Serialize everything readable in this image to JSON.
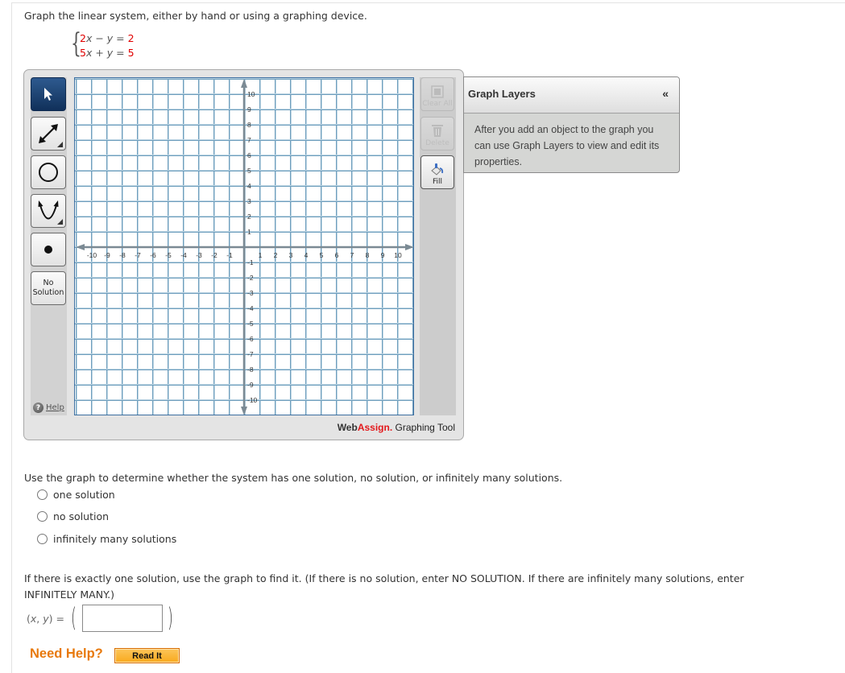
{
  "instructions": "Graph the linear system, either by hand or using a graphing device.",
  "system": {
    "eq1": {
      "coef": "2",
      "var1": "x",
      "op": " − ",
      "var2": "y",
      "eq": " = ",
      "rhs": "2"
    },
    "eq2": {
      "coef": "5",
      "var1": "x",
      "op": " + ",
      "var2": "y",
      "eq": " = ",
      "rhs": "5"
    }
  },
  "toolbar": {
    "tools": [
      {
        "name": "select",
        "icon": "arrow-pointer-icon",
        "selected": true
      },
      {
        "name": "line",
        "icon": "line-tool-icon"
      },
      {
        "name": "circle",
        "icon": "circle-tool-icon"
      },
      {
        "name": "parabola",
        "icon": "parabola-tool-icon"
      },
      {
        "name": "point",
        "icon": "point-tool-icon"
      }
    ],
    "no_solution_line1": "No",
    "no_solution_line2": "Solution",
    "help": "Help"
  },
  "right_tools": {
    "clear_all": "Clear All",
    "delete": "Delete",
    "fill": "Fill"
  },
  "brand": {
    "web": "Web",
    "assign": "Assign.",
    "tool": " Graphing Tool"
  },
  "graph_layers": {
    "title": "Graph Layers",
    "collapse": "«",
    "body": "After you add an object to the graph you can use Graph Layers to view and edit its properties."
  },
  "graph": {
    "x_range": [
      -11,
      11
    ],
    "y_range": [
      -11,
      11
    ],
    "tick_min": -10,
    "tick_max": 10,
    "tick_step": 1,
    "colors": {
      "grid_dark": "#6e9ebd",
      "grid_light": "#bdd5e3",
      "axis": "#7b8a94",
      "label": "#333333"
    }
  },
  "question": {
    "prompt": "Use the graph to determine whether the system has one solution, no solution, or infinitely many solutions.",
    "options": [
      "one solution",
      "no solution",
      "infinitely many solutions"
    ]
  },
  "solution_prompt": "If there is exactly one solution, use the graph to find it. (If there is no solution, enter NO SOLUTION. If there are infinitely many solutions, enter INFINITELY MANY.)",
  "answer": {
    "label_open": "(",
    "label_x": "x",
    "label_sep": ", ",
    "label_y": "y",
    "label_close": ") =",
    "paren_open": "(",
    "paren_close": ")",
    "value": ""
  },
  "help": {
    "need_help": "Need Help?",
    "read_it": "Read It"
  }
}
